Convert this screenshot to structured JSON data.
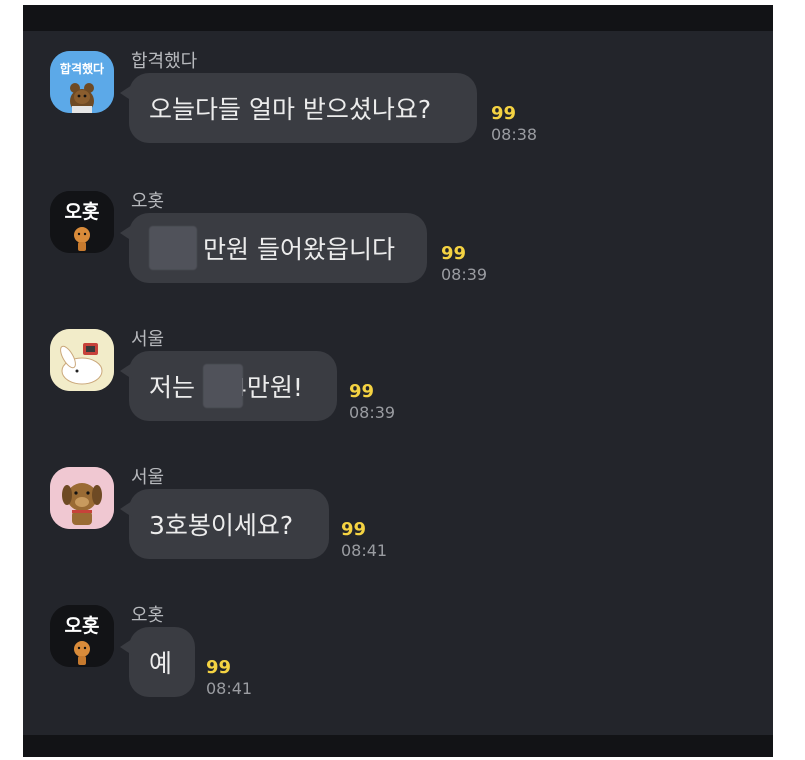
{
  "messages": [
    {
      "sender": "합격했다",
      "avatar_label": "합격했다",
      "text": "오늘다들 얼마 받으셨나요?",
      "count": "99",
      "time": "08:38"
    },
    {
      "sender": "오홋",
      "avatar_label": "오홋",
      "text_after": "만원 들어왔읍니다",
      "count": "99",
      "time": "08:39"
    },
    {
      "sender": "서울",
      "text_before": "저는",
      "text_after": "4만원!",
      "count": "99",
      "time": "08:39"
    },
    {
      "sender": "서울",
      "text": "3호봉이세요?",
      "count": "99",
      "time": "08:41"
    },
    {
      "sender": "오홋",
      "avatar_label": "오홋",
      "text": "예",
      "count": "99",
      "time": "08:41"
    }
  ],
  "colors": {
    "background": "#23252b",
    "bubble": "#3a3c42",
    "unread_count": "#f5d342",
    "timestamp": "#9a9ca1"
  },
  "icons": [
    "avatar-bear-hapgyeok",
    "avatar-ohot-character",
    "avatar-rabbit-tv",
    "avatar-dog"
  ]
}
